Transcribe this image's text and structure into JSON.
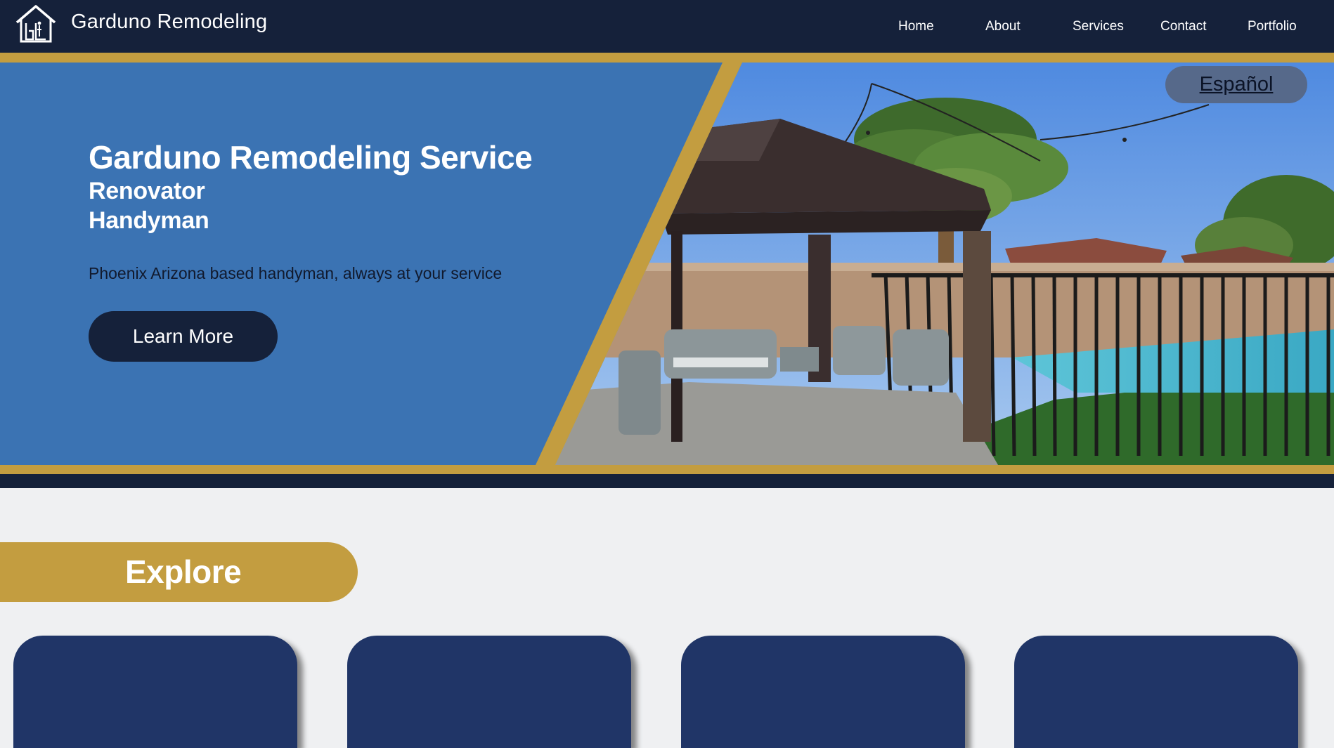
{
  "navbar": {
    "brand": "Garduno Remodeling",
    "logo_icon": "house-logo-icon",
    "links": [
      {
        "label": "Home"
      },
      {
        "label": "About"
      },
      {
        "label": "Services"
      },
      {
        "label": "Contact"
      },
      {
        "label": "Portfolio"
      }
    ]
  },
  "hero": {
    "title": "Garduno Remodeling Service",
    "subtitle_1": "Renovator",
    "subtitle_2": "Handyman",
    "tagline": "Phoenix Arizona based handyman, always at your service",
    "cta_label": "Learn More",
    "language_label": "Español"
  },
  "explore": {
    "label": "Explore",
    "cards": [
      {},
      {},
      {},
      {}
    ]
  },
  "colors": {
    "navy": "#15213a",
    "gold": "#c39d40",
    "hero_blue": "#3b73b3",
    "card_navy": "#203567",
    "page_bg": "#eff0f2"
  }
}
